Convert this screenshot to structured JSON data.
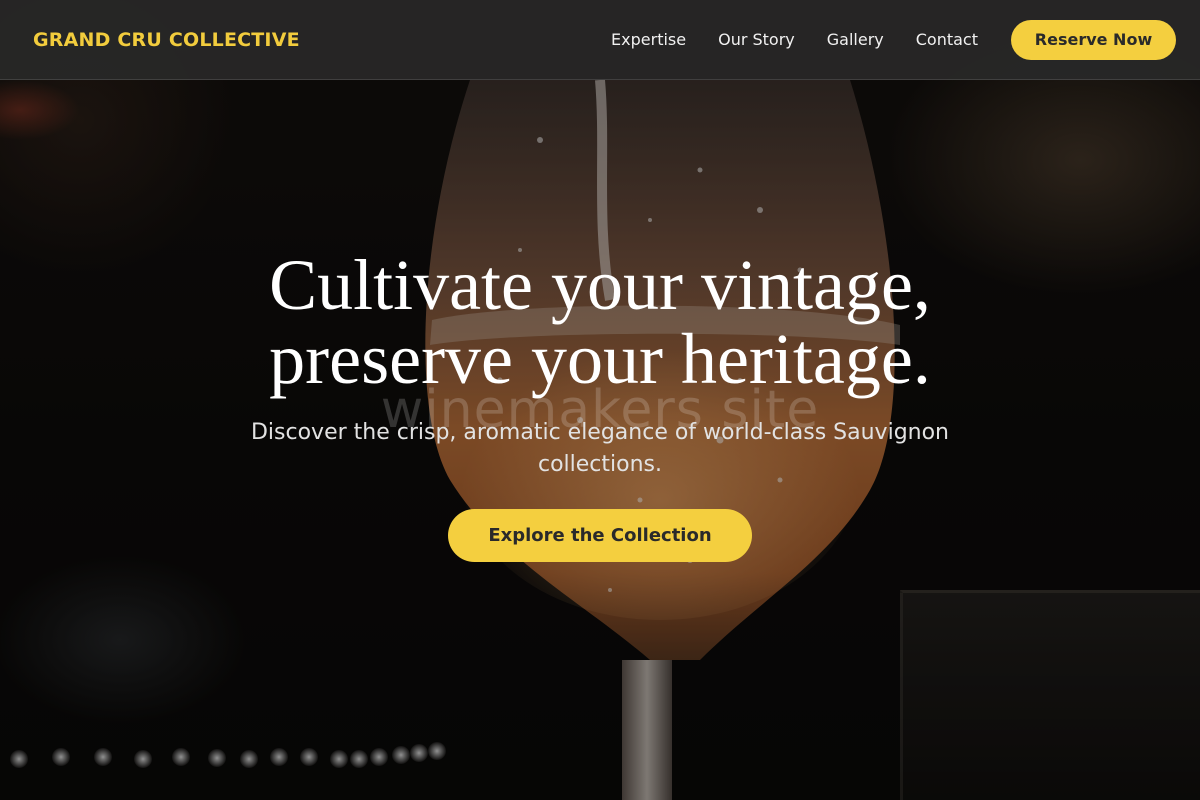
{
  "header": {
    "logo": "GRAND CRU COLLECTIVE",
    "nav": [
      {
        "label": "Expertise"
      },
      {
        "label": "Our Story"
      },
      {
        "label": "Gallery"
      },
      {
        "label": "Contact"
      }
    ],
    "cta": "Reserve Now"
  },
  "hero": {
    "headline_line1": "Cultivate your vintage,",
    "headline_line2": "preserve your heritage.",
    "watermark": "winemakers site",
    "subhead": "Discover the crisp, aromatic elegance of world-class Sauvignon collections.",
    "cta": "Explore the Collection"
  },
  "colors": {
    "accent": "#f4cf3f",
    "logo": "#f2cc3d",
    "header_bg": "#282828",
    "text_light": "#ffffff"
  }
}
